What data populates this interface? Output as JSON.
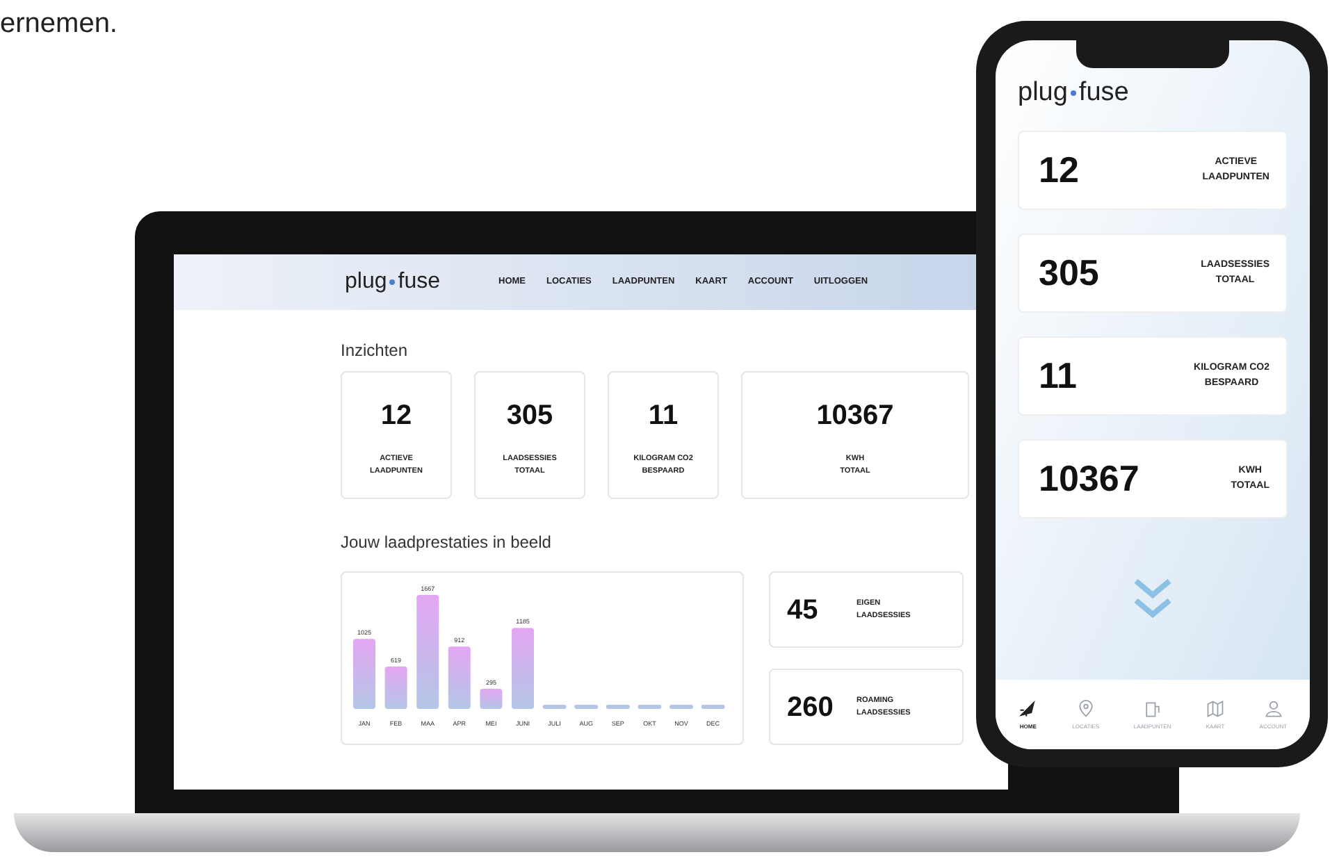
{
  "caption_fragment": "ernemen.",
  "laptop": {
    "logo": {
      "left": "plug",
      "right": "fuse"
    },
    "nav": [
      {
        "label": "HOME"
      },
      {
        "label": "LOCATIES"
      },
      {
        "label": "LAADPUNTEN"
      },
      {
        "label": "KAART"
      },
      {
        "label": "ACCOUNT"
      },
      {
        "label": "UITLOGGEN"
      }
    ],
    "insights_title": "Inzichten",
    "stats": [
      {
        "value": "12",
        "label": [
          "ACTIEVE",
          "LAADPUNTEN"
        ]
      },
      {
        "value": "305",
        "label": [
          "LAADSESSIES",
          "TOTAAL"
        ]
      },
      {
        "value": "11",
        "label": [
          "KILOGRAM CO2",
          "BESPAARD"
        ]
      },
      {
        "value": "10367",
        "label": [
          "KWH",
          "TOTAAL"
        ]
      }
    ],
    "performance_title": "Jouw laadprestaties in beeld",
    "chart_data": {
      "type": "bar",
      "categories": [
        "JAN",
        "FEB",
        "MAA",
        "APR",
        "MEI",
        "JUNI",
        "JULI",
        "AUG",
        "SEP",
        "OKT",
        "NOV",
        "DEC"
      ],
      "series": [
        {
          "color": "#b3c6e6",
          "values": [
            1025,
            619,
            1667,
            912,
            295,
            1185,
            null,
            null,
            null,
            null,
            null,
            null
          ]
        }
      ],
      "data_labels": true
    },
    "session_cards": [
      {
        "value": "45",
        "label": [
          "EIGEN",
          "LAADSESSIES"
        ]
      },
      {
        "value": "260",
        "label": [
          "ROAMING",
          "LAADSESSIES"
        ]
      }
    ]
  },
  "phone": {
    "logo": {
      "left": "plug",
      "right": "fuse"
    },
    "stats": [
      {
        "value": "12",
        "label": [
          "ACTIEVE",
          "LAADPUNTEN"
        ]
      },
      {
        "value": "305",
        "label": [
          "LAADSESSIES",
          "TOTAAL"
        ]
      },
      {
        "value": "11",
        "label": [
          "KILOGRAM CO2",
          "BESPAARD"
        ]
      },
      {
        "value": "10367",
        "label": [
          "KWH",
          "TOTAAL"
        ]
      }
    ],
    "tabs": [
      {
        "kind": "rocket",
        "label": "HOME",
        "selected": true
      },
      {
        "kind": "pin",
        "label": "LOCATIES",
        "selected": false
      },
      {
        "kind": "charger",
        "label": "LAADPUNTEN",
        "selected": false
      },
      {
        "kind": "map",
        "label": "KAART",
        "selected": false
      },
      {
        "kind": "user",
        "label": "ACCOUNT",
        "selected": false
      }
    ]
  }
}
